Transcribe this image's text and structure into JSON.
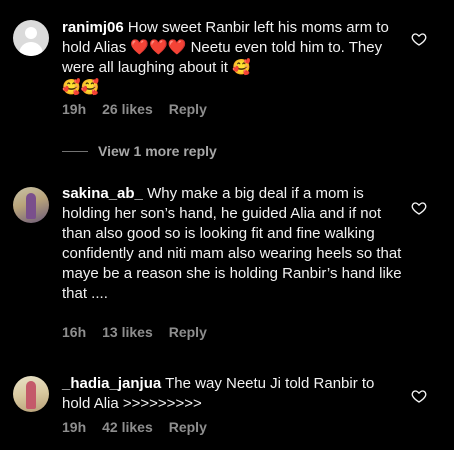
{
  "comments": [
    {
      "username": "ranimj06",
      "text": "How sweet Ranbir left his moms arm to hold Alias ❤️❤️❤️ Neetu even told him to. They were all laughing about it 🥰\n🥰🥰",
      "time": "19h",
      "likes": "26 likes",
      "reply": "Reply"
    },
    {
      "username": "sakina_ab_",
      "text": "Why make a big deal if a mom is holding her son’s hand, he guided Alia and if not than also good so is looking fit and fine walking confidently and niti mam also wearing heels so that maye be a reason she is holding Ranbir’s hand like that ....",
      "time": "16h",
      "likes": "13 likes",
      "reply": "Reply"
    },
    {
      "username": "_hadia_janjua",
      "text": "The way Neetu Ji told Ranbir to hold Alia >>>>>>>>>",
      "time": "19h",
      "likes": "42 likes",
      "reply": "Reply"
    }
  ],
  "view_more": "View 1 more reply",
  "icons": {
    "like": "heart-outline-icon"
  },
  "colors": {
    "background": "#000000",
    "meta": "#8e8e8e"
  }
}
